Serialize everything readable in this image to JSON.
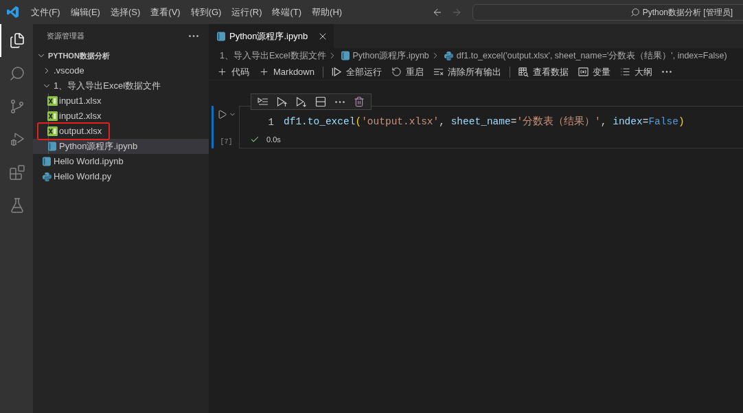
{
  "title_bar": {
    "menus": [
      "文件(F)",
      "编辑(E)",
      "选择(S)",
      "查看(V)",
      "转到(G)",
      "运行(R)",
      "终端(T)",
      "帮助(H)"
    ],
    "navigation": [
      {
        "kind": "back",
        "disabled": false
      },
      {
        "kind": "forward",
        "disabled": true
      }
    ],
    "command_center": "Python数据分析 [管理员]"
  },
  "activity_bar": {
    "items": [
      {
        "kind": "explorer",
        "selected": true
      },
      {
        "kind": "search",
        "selected": false
      },
      {
        "kind": "source-control",
        "selected": false
      },
      {
        "kind": "run-debug",
        "selected": false
      },
      {
        "kind": "extensions",
        "selected": false
      },
      {
        "kind": "testing",
        "selected": false
      }
    ]
  },
  "sidebar": {
    "title": "资源管理器",
    "tree": [
      {
        "label": "PYTHON数据分析",
        "kind": "folder",
        "expanded": true,
        "selected": false,
        "children": [
          {
            "label": ".vscode",
            "kind": "folder",
            "expanded": false,
            "selected": false
          },
          {
            "label": "1、导入导出Excel数据文件",
            "kind": "folder",
            "expanded": true,
            "selected": false,
            "children": [
              {
                "label": "input1.xlsx",
                "kind": "excel",
                "selected": false,
                "highlighted": false
              },
              {
                "label": "input2.xlsx",
                "kind": "excel",
                "selected": false,
                "highlighted": false
              },
              {
                "label": "output.xlsx",
                "kind": "excel",
                "selected": false,
                "highlighted": true
              },
              {
                "label": "Python源程序.ipynb",
                "kind": "notebook",
                "selected": true,
                "highlighted": false
              }
            ]
          },
          {
            "label": "Hello World.ipynb",
            "kind": "notebook",
            "selected": false,
            "highlighted": false
          },
          {
            "label": "Hello World.py",
            "kind": "python",
            "selected": false,
            "highlighted": false
          }
        ]
      }
    ]
  },
  "editor": {
    "tabs": [
      {
        "label": "Python源程序.ipynb",
        "kind": "notebook",
        "selected": true
      }
    ],
    "breadcrumbs": [
      {
        "label": "1、导入导出Excel数据文件",
        "kind": "folder"
      },
      {
        "label": "Python源程序.ipynb",
        "kind": "notebook"
      },
      {
        "label": "df1.to_excel('output.xlsx', sheet_name='分数表（结果）', index=False)",
        "kind": "python"
      }
    ],
    "toolbar": [
      {
        "kind": "add",
        "label": "代码"
      },
      {
        "kind": "add",
        "label": "Markdown"
      },
      {
        "kind": "separator"
      },
      {
        "kind": "run-all",
        "label": "全部运行"
      },
      {
        "kind": "restart",
        "label": "重启"
      },
      {
        "kind": "clear",
        "label": "清除所有输出"
      },
      {
        "kind": "separator"
      },
      {
        "kind": "data",
        "label": "查看数据"
      },
      {
        "kind": "variables",
        "label": "变量"
      },
      {
        "kind": "outline",
        "label": "大纲"
      },
      {
        "kind": "more"
      }
    ],
    "cell": {
      "focused": true,
      "toolbar": [
        {
          "kind": "run-by-line"
        },
        {
          "kind": "run-above"
        },
        {
          "kind": "run-below"
        },
        {
          "kind": "split"
        },
        {
          "kind": "more"
        },
        {
          "kind": "delete"
        }
      ],
      "line_number": "1",
      "code": [
        {
          "kind": "variable",
          "text": "df1"
        },
        {
          "kind": "plain",
          "text": "."
        },
        {
          "kind": "variable",
          "text": "to_excel"
        },
        {
          "kind": "bracket",
          "text": "("
        },
        {
          "kind": "string",
          "text": "'output.xlsx'"
        },
        {
          "kind": "plain",
          "text": ", "
        },
        {
          "kind": "variable",
          "text": "sheet_name"
        },
        {
          "kind": "plain",
          "text": "="
        },
        {
          "kind": "string",
          "text": "'分数表（结果）'"
        },
        {
          "kind": "plain",
          "text": ", "
        },
        {
          "kind": "variable",
          "text": "index"
        },
        {
          "kind": "plain",
          "text": "="
        },
        {
          "kind": "keyword",
          "text": "False"
        },
        {
          "kind": "bracket",
          "text": ")"
        }
      ],
      "execution_count": "[7]",
      "succeeded": true,
      "duration": "0.0s"
    }
  }
}
